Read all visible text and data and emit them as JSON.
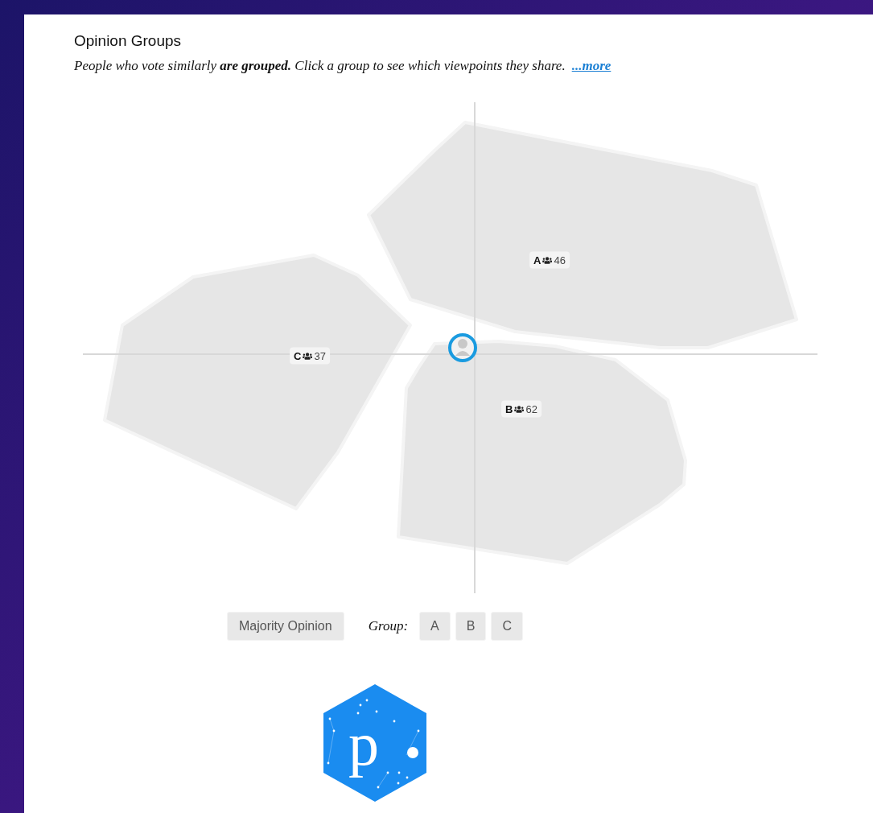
{
  "title": "Opinion Groups",
  "description": "People who vote similarly **are grouped.** Click a group to see which viewpoints they share.",
  "more_link": "...more",
  "groups": [
    {
      "label": "A",
      "count": "46"
    },
    {
      "label": "B",
      "count": "62"
    },
    {
      "label": "C",
      "count": "37"
    }
  ],
  "majority_button": "Majority Opinion",
  "group_filter_label": "Group:",
  "group_buttons": [
    "A",
    "B",
    "C"
  ],
  "logo": {
    "text": "p"
  }
}
